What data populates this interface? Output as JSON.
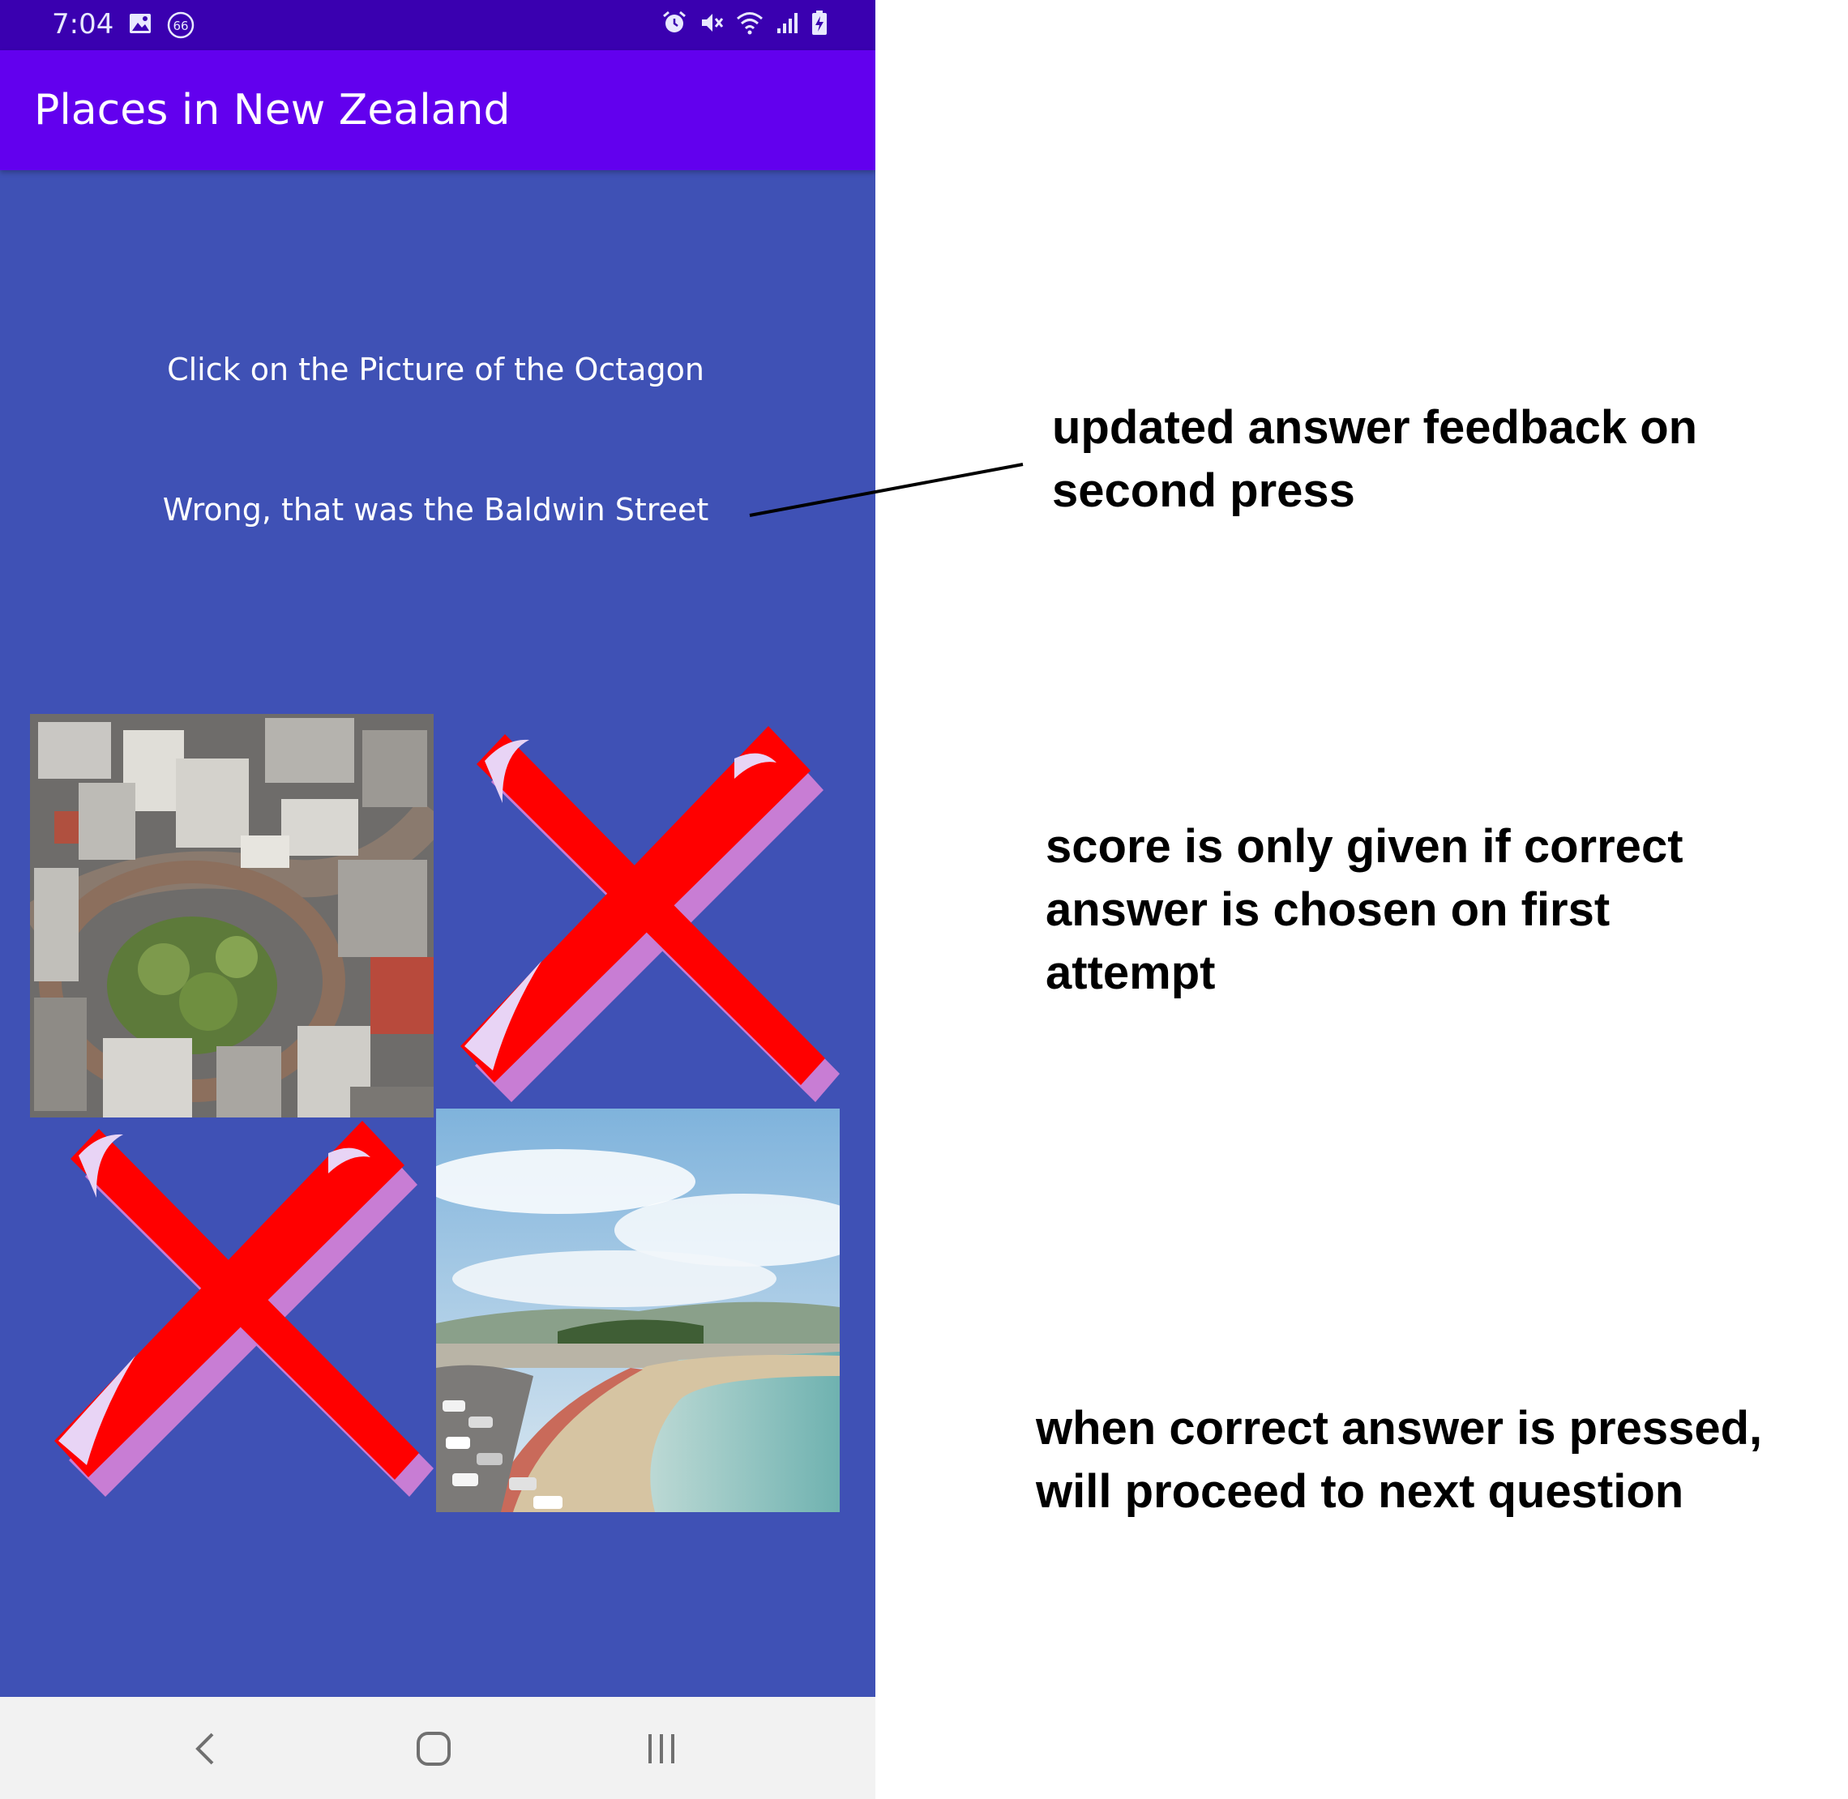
{
  "status_bar": {
    "time": "7:04",
    "left_icons": [
      "image-icon",
      "notification-badge-icon"
    ],
    "badge_text": "66",
    "right_icons": [
      "alarm-icon",
      "mute-icon",
      "wifi-icon",
      "signal-icon",
      "battery-charging-icon"
    ]
  },
  "app_bar": {
    "title": "Places in New Zealand"
  },
  "quiz": {
    "question": "Click on the Picture of the Octagon",
    "feedback": "Wrong, that was the Baldwin Street",
    "tiles": [
      {
        "position": "top-left",
        "content": "aerial city photo"
      },
      {
        "position": "top-right",
        "content": "red cross mark"
      },
      {
        "position": "bottom-left",
        "content": "red cross mark"
      },
      {
        "position": "bottom-right",
        "content": "beach photo"
      }
    ]
  },
  "nav_bar": {
    "icons": [
      "back-icon",
      "home-icon",
      "recents-icon"
    ]
  },
  "annotations": {
    "feedback_note": "updated answer feedback on second press",
    "score_note": "score is only given if correct answer is chosen on first attempt",
    "proceed_note": "when correct answer is pressed, will proceed to next question"
  },
  "colors": {
    "status_bar": "#3a00b0",
    "app_bar": "#6200ee",
    "content_background": "#3f51b5",
    "cross": "#ff0000",
    "nav_bar": "#f2f2f2"
  }
}
